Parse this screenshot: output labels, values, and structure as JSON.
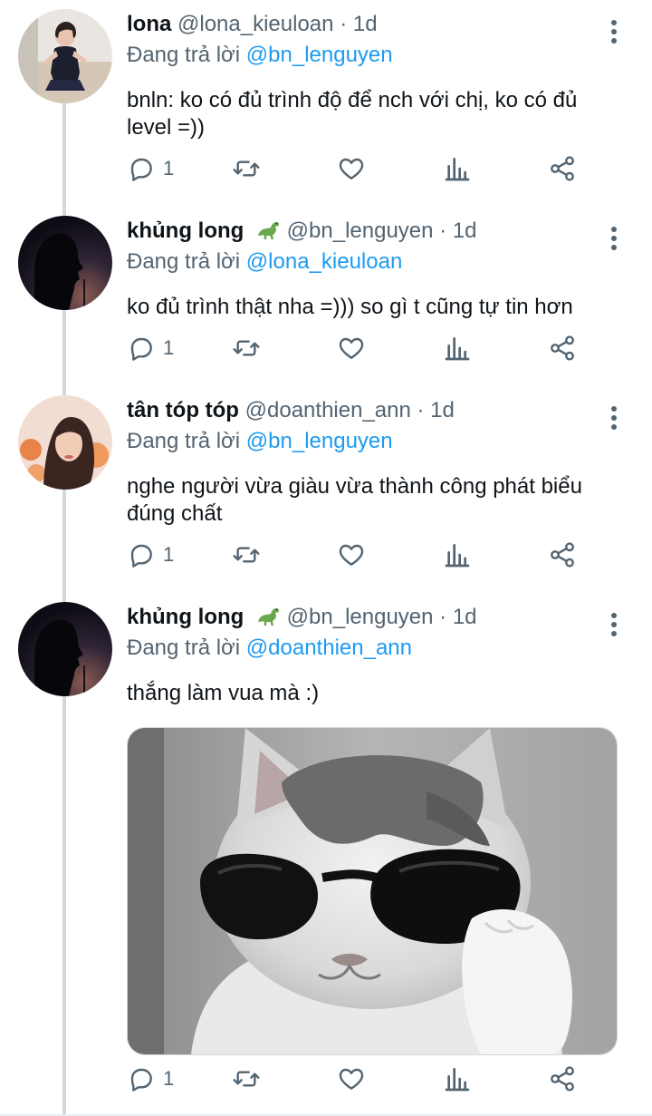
{
  "tweets": [
    {
      "name": "lona",
      "has_emoji": false,
      "handle": "@lona_kieuloan",
      "time": "1d",
      "replying_prefix": "Đang trả lời",
      "replying_to": "@bn_lenguyen",
      "text": "bnln: ko có đủ trình độ để nch với chị, ko có đủ level =))",
      "reply_count": "1"
    },
    {
      "name": "khủng long",
      "has_emoji": true,
      "handle": "@bn_lenguyen",
      "time": "1d",
      "replying_prefix": "Đang trả lời",
      "replying_to": "@lona_kieuloan",
      "text": "ko đủ trình thật nha =))) so gì t cũng tự tin hơn",
      "reply_count": "1"
    },
    {
      "name": "tân tóp tóp",
      "has_emoji": false,
      "handle": "@doanthien_ann",
      "time": "1d",
      "replying_prefix": "Đang trả lời",
      "replying_to": "@bn_lenguyen",
      "text": "nghe người vừa giàu vừa thành công phát biểu đúng chất",
      "reply_count": "1"
    },
    {
      "name": "khủng long",
      "has_emoji": true,
      "handle": "@bn_lenguyen",
      "time": "1d",
      "replying_prefix": "Đang trả lời",
      "replying_to": "@doanthien_ann",
      "text": "thắng làm vua mà :)",
      "reply_count": "1",
      "media": "cat-with-sunglasses-image"
    }
  ],
  "separator": "·",
  "colors": {
    "text": "#0f1419",
    "secondary": "#536471",
    "link": "#1d9bf0",
    "thread_line": "#cfd9de"
  },
  "icons": [
    "reply-icon",
    "retweet-icon",
    "like-icon",
    "views-icon",
    "share-icon",
    "more-icon",
    "dinosaur-emoji"
  ]
}
